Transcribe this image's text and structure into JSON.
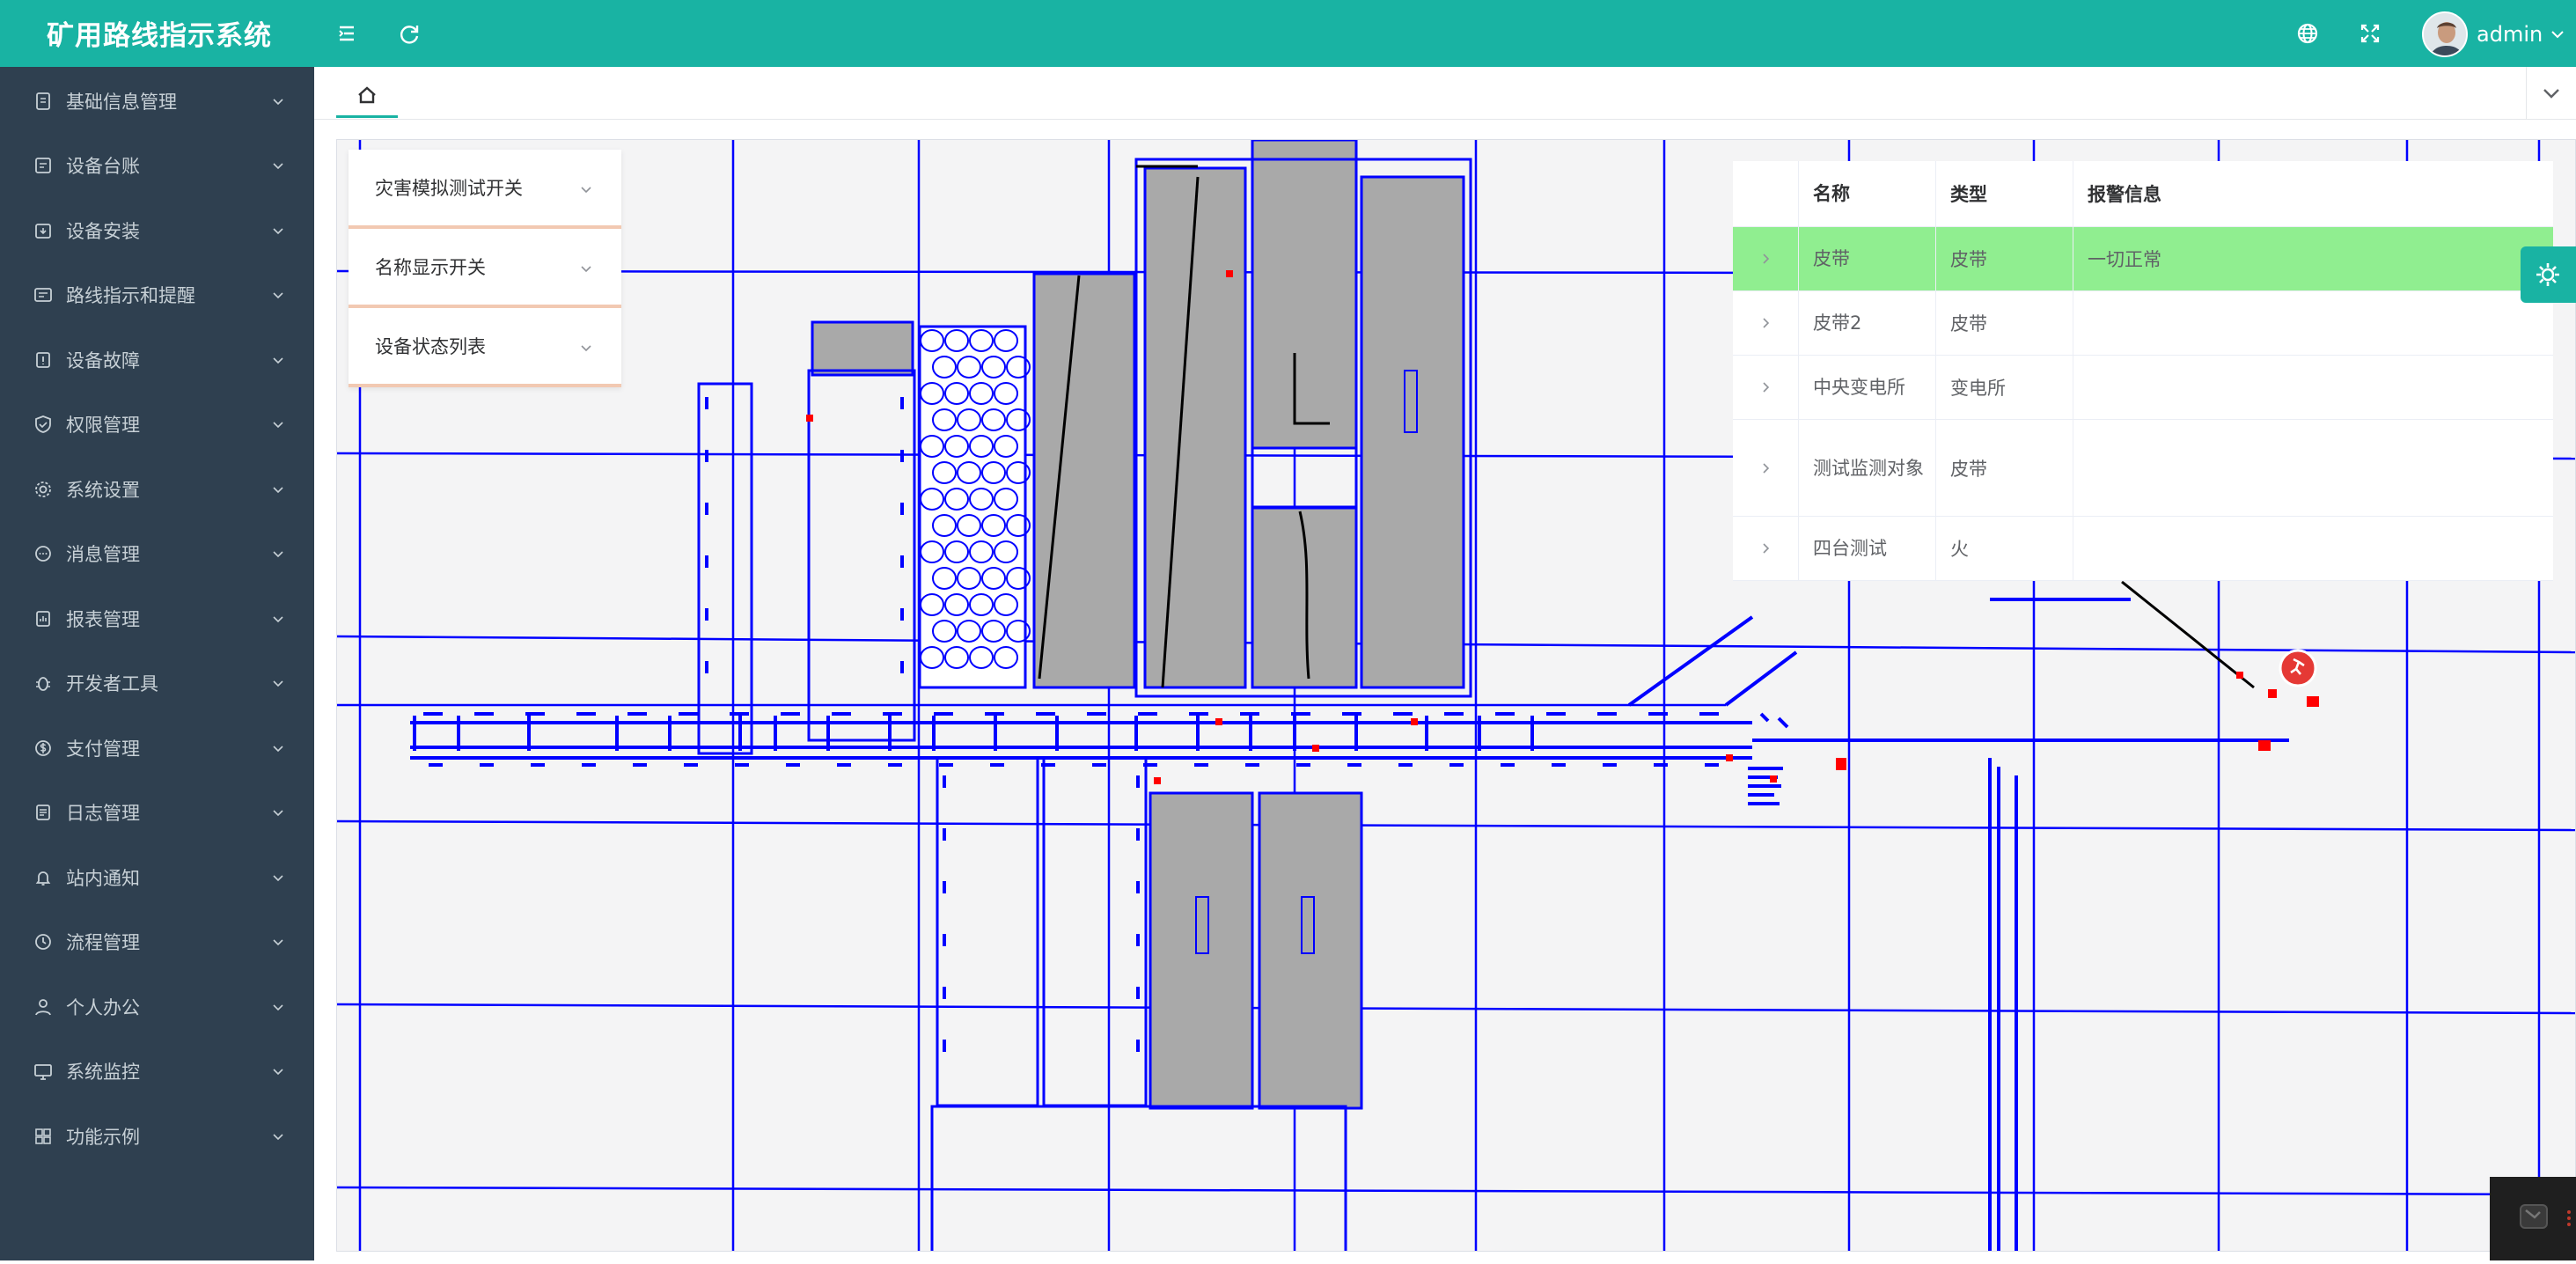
{
  "app": {
    "title": "矿用路线指示系统"
  },
  "header": {
    "username": "admin"
  },
  "sidebar": {
    "items": [
      {
        "label": "基础信息管理",
        "icon": "document-icon"
      },
      {
        "label": "设备台账",
        "icon": "ledger-icon"
      },
      {
        "label": "设备安装",
        "icon": "install-icon"
      },
      {
        "label": "路线指示和提醒",
        "icon": "route-icon"
      },
      {
        "label": "设备故障",
        "icon": "fault-icon"
      },
      {
        "label": "权限管理",
        "icon": "shield-icon"
      },
      {
        "label": "系统设置",
        "icon": "gear-icon"
      },
      {
        "label": "消息管理",
        "icon": "chat-icon"
      },
      {
        "label": "报表管理",
        "icon": "report-icon"
      },
      {
        "label": "开发者工具",
        "icon": "bug-icon"
      },
      {
        "label": "支付管理",
        "icon": "dollar-icon"
      },
      {
        "label": "日志管理",
        "icon": "log-icon"
      },
      {
        "label": "站内通知",
        "icon": "bell-icon"
      },
      {
        "label": "流程管理",
        "icon": "clock-icon"
      },
      {
        "label": "个人办公",
        "icon": "user-icon"
      },
      {
        "label": "系统监控",
        "icon": "monitor-icon"
      },
      {
        "label": "功能示例",
        "icon": "grid-icon"
      }
    ]
  },
  "panels": {
    "items": [
      {
        "label": "灾害模拟测试开关"
      },
      {
        "label": "名称显示开关"
      },
      {
        "label": "设备状态列表"
      }
    ]
  },
  "table": {
    "headers": [
      "名称",
      "类型",
      "报警信息"
    ],
    "rows": [
      {
        "name": "皮带",
        "type": "皮带",
        "alarm": "一切正常",
        "highlight": true
      },
      {
        "name": "皮带2",
        "type": "皮带",
        "alarm": ""
      },
      {
        "name": "中央变电所",
        "type": "变电所",
        "alarm": ""
      },
      {
        "name": "测试监测对象",
        "type": "皮带",
        "alarm": ""
      },
      {
        "name": "四台测试",
        "type": "火",
        "alarm": ""
      }
    ]
  },
  "colors": {
    "brand": "#19b3a3",
    "sidebar_bg": "#2f4050",
    "map_line": "#0000ff",
    "alarm_row": "#90ee90",
    "building_fill": "#a9a9a9",
    "marker_red": "#ff0000"
  }
}
